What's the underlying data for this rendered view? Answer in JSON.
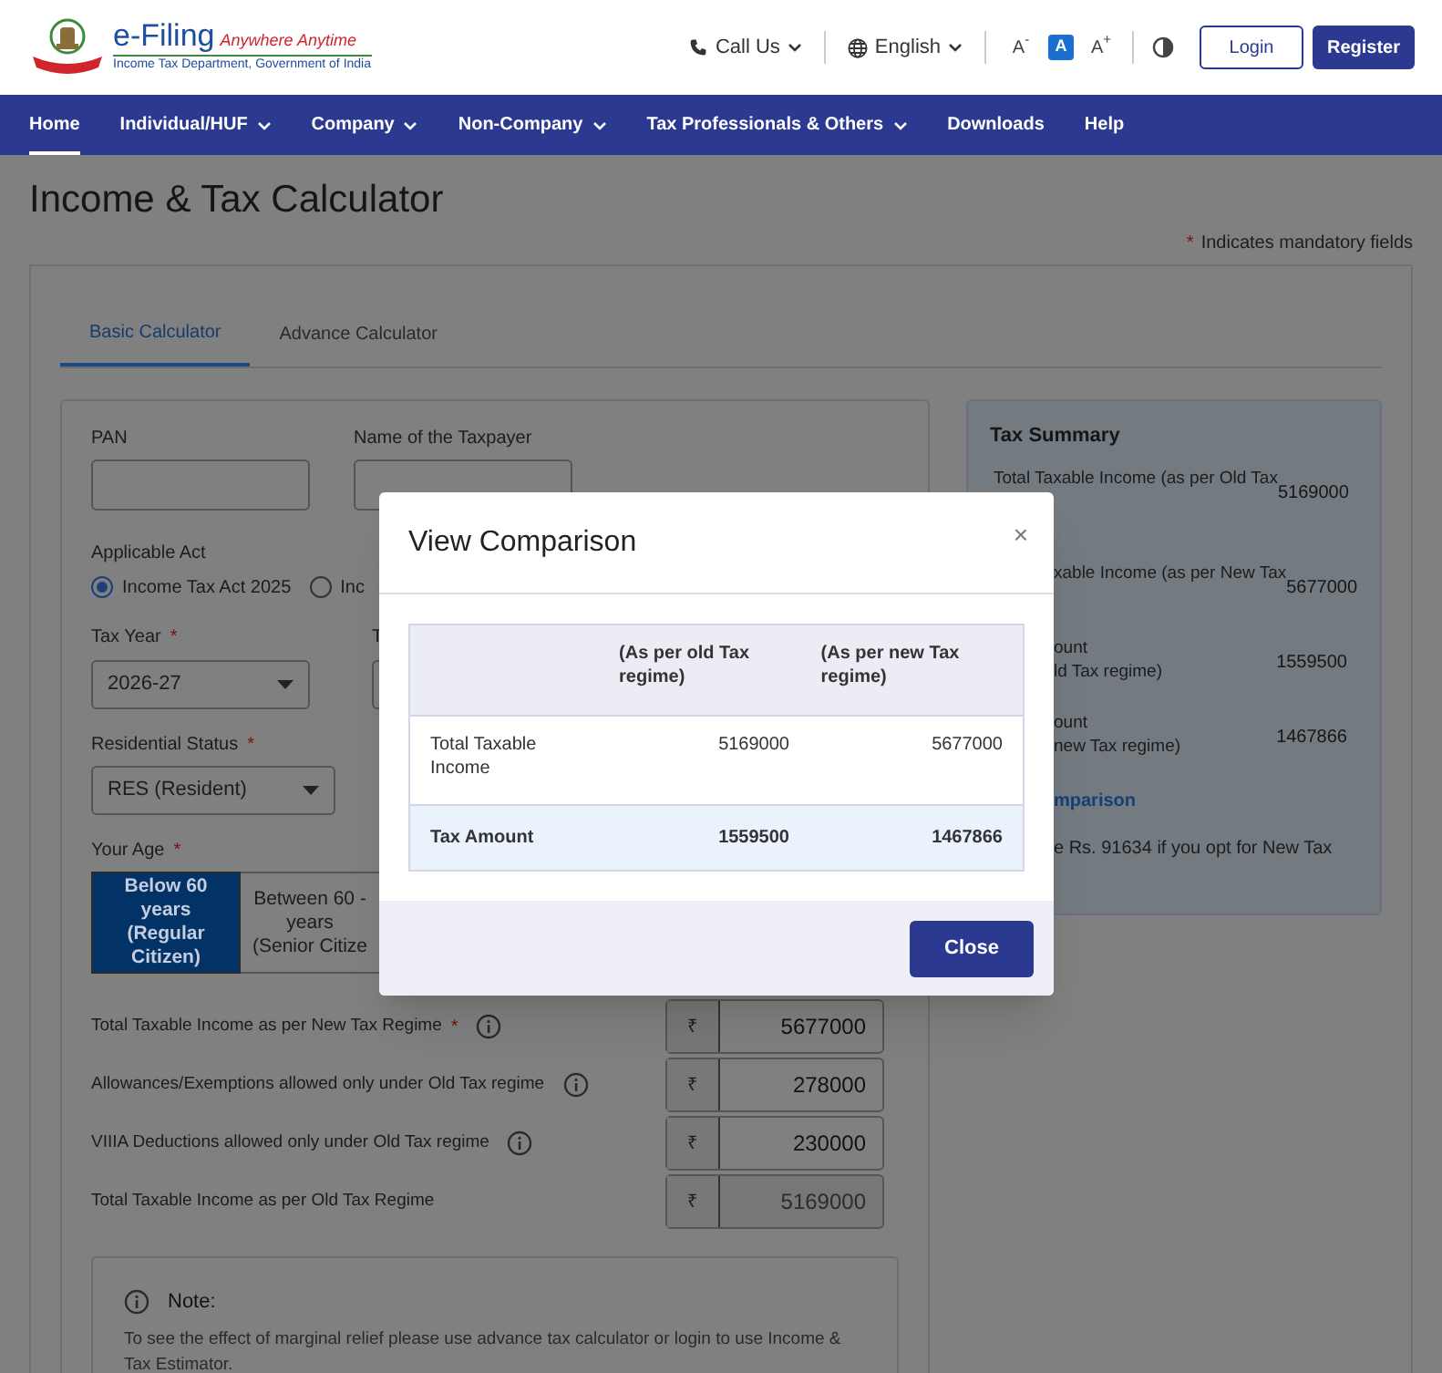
{
  "header": {
    "logo_title": "e-Filing",
    "logo_tagline": "Anywhere Anytime",
    "logo_subtitle": "Income Tax Department, Government of India",
    "call_us": "Call Us",
    "language": "English",
    "font_controls": [
      {
        "label": "A$^{-}$",
        "selected": false
      },
      {
        "label": "A",
        "selected": true
      },
      {
        "label": "A$^{+}$",
        "selected": false
      }
    ],
    "login": "Login",
    "register": "Register"
  },
  "nav": [
    {
      "label": "Home",
      "selected": true,
      "dropdown": false
    },
    {
      "label": "Individual/HUF",
      "selected": false,
      "dropdown": true
    },
    {
      "label": "Company",
      "selected": false,
      "dropdown": true
    },
    {
      "label": "Non-Company",
      "selected": false,
      "dropdown": true
    },
    {
      "label": "Tax Professionals & Others",
      "selected": false,
      "dropdown": true
    },
    {
      "label": "Downloads",
      "selected": false,
      "dropdown": false
    },
    {
      "label": "Help",
      "selected": false,
      "dropdown": false
    }
  ],
  "page_title": "Income & Tax Calculator",
  "mandatory_note": {
    "mark": "*",
    "text": "Indicates mandatory fields"
  },
  "tabs": [
    {
      "label": "Basic Calculator",
      "selected": true
    },
    {
      "label": "Advance Calculator",
      "selected": false
    }
  ],
  "form": {
    "pan": {
      "label": "PAN"
    },
    "taxpayer_name": {
      "label": "Name of the Taxpayer"
    },
    "applicable_act": {
      "label": "Applicable Act",
      "options": [
        {
          "label": "Income Tax Act 2025",
          "selected": true
        },
        {
          "label": "Inc",
          "selected": false
        }
      ]
    },
    "tax_year": {
      "label": "Tax Year",
      "mark": "*",
      "value": "2026-27"
    },
    "tax_year_neighbor": {
      "label": "T"
    },
    "residential_status": {
      "label": "Residential Status",
      "mark": "*",
      "value": "RES (Resident)"
    },
    "age": {
      "label": "Your Age",
      "mark": "*",
      "options": [
        {
          "lines": [
            "Below 60",
            "years",
            "(Regular",
            "Citizen)"
          ],
          "selected": true
        },
        {
          "lines": [
            "Between 60 -",
            "years",
            "(Senior Citize"
          ],
          "selected": false
        }
      ]
    },
    "income_rows": [
      {
        "label": "Total Taxable Income as per New Tax Regime",
        "mark": "*",
        "info": true,
        "currency": "₹",
        "value": "5677000",
        "disabled": false
      },
      {
        "label": "Allowances/Exemptions allowed only under Old Tax regime",
        "info": true,
        "currency": "₹",
        "value": "278000",
        "disabled": false
      },
      {
        "label": "VIIIA Deductions allowed only under Old Tax regime",
        "info": true,
        "currency": "₹",
        "value": "230000",
        "disabled": false
      },
      {
        "label": "Total Taxable Income as per Old Tax Regime",
        "info": false,
        "currency": "₹",
        "value": "5169000",
        "disabled": true
      }
    ],
    "note": {
      "title": "Note:",
      "text": "To see the effect of marginal relief please use advance tax calculator or login to use Income & Tax Estimator."
    }
  },
  "tax_summary": {
    "title": "Tax Summary",
    "rows": [
      {
        "label_lines": [
          "Total Taxable Income (as per Old Tax"
        ],
        "value": "5169000"
      },
      {
        "label_lines": [
          "xable Income (as per New Tax"
        ],
        "value": "5677000"
      },
      {
        "label_lines": [
          "ount",
          "ld Tax regime)"
        ],
        "value": "1559500"
      },
      {
        "label_lines": [
          "ount",
          "new Tax regime)"
        ],
        "value": "1467866"
      }
    ],
    "link": "mparison",
    "message": "e Rs. 91634 if you opt for New Tax"
  },
  "modal": {
    "title": "View Comparison",
    "close_icon": "×",
    "columns": [
      "(As per old Tax regime)",
      "(As per new Tax regime)"
    ],
    "rows": [
      {
        "label": "Total Taxable Income",
        "values": [
          "5169000",
          "5677000"
        ],
        "highlighted": false
      },
      {
        "label": "Tax Amount",
        "values": [
          "1559500",
          "1467866"
        ],
        "highlighted": true
      }
    ],
    "button": "Close"
  }
}
